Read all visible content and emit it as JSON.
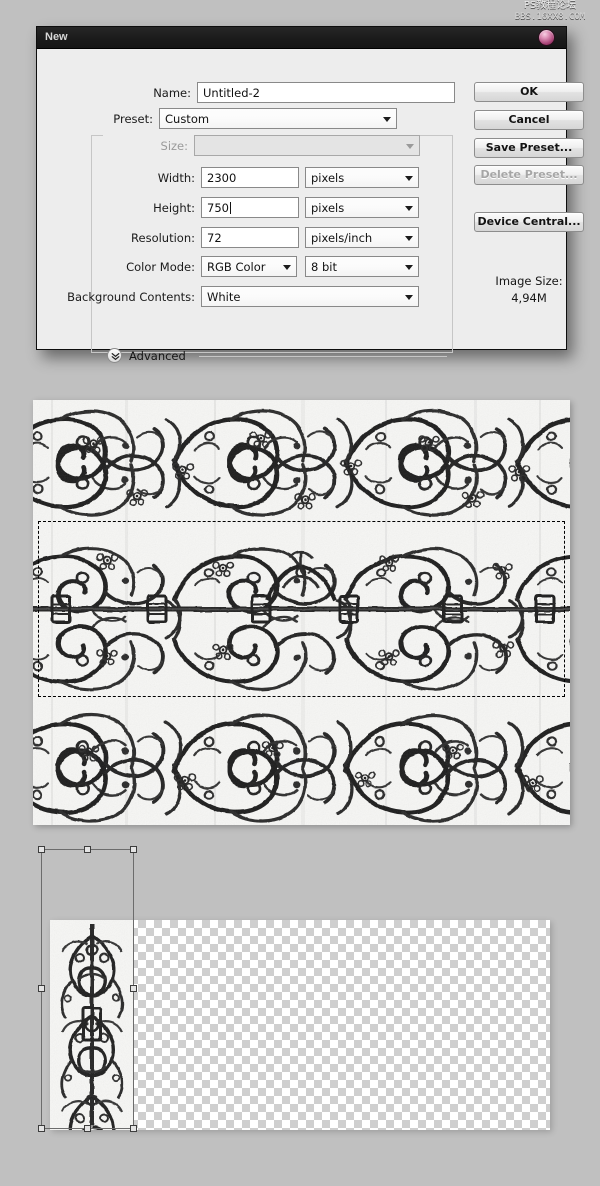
{
  "watermark": {
    "line1": "PS教程论坛",
    "line2": "BBS.16XX8.COM"
  },
  "dialog": {
    "title": "New",
    "close_icon": "close-circle-icon",
    "fields": {
      "name": {
        "label": "Name:",
        "value": "Untitled-2"
      },
      "preset": {
        "label": "Preset:",
        "value": "Custom"
      },
      "size": {
        "label": "Size:",
        "value": "",
        "disabled": true
      },
      "width": {
        "label": "Width:",
        "value": "2300",
        "unit": "pixels"
      },
      "height": {
        "label": "Height:",
        "value": "750",
        "unit": "pixels",
        "has_caret": true
      },
      "resolution": {
        "label": "Resolution:",
        "value": "72",
        "unit": "pixels/inch"
      },
      "color_mode": {
        "label": "Color Mode:",
        "value": "RGB Color",
        "depth": "8 bit"
      },
      "background_contents": {
        "label": "Background Contents:",
        "value": "White"
      }
    },
    "buttons": [
      {
        "label": "OK",
        "disabled": false
      },
      {
        "label": "Cancel",
        "disabled": false
      },
      {
        "label": "Save Preset...",
        "disabled": false
      },
      {
        "label": "Delete Preset...",
        "disabled": true
      },
      {
        "label": "Device Central...",
        "disabled": false
      }
    ],
    "image_size": {
      "label": "Image Size:",
      "value": "4,94M"
    },
    "advanced": {
      "label": "Advanced",
      "icon": "chevron-double-down-icon"
    }
  },
  "canvas": {
    "ornament_panel": {
      "description": "Black and white ornamental scrollwork pattern",
      "selection": "rectangular-marquee"
    },
    "paste_panel": {
      "description": "Pasted ornamental strip on transparent checkerboard",
      "transform": "free-transform-bounding-box"
    }
  },
  "colors": {
    "background": "#c0c0c0",
    "dialog_face": "#ededed",
    "titlebar": "#1b1b1b",
    "close_button": "#a43e72",
    "field_border": "#898989"
  }
}
